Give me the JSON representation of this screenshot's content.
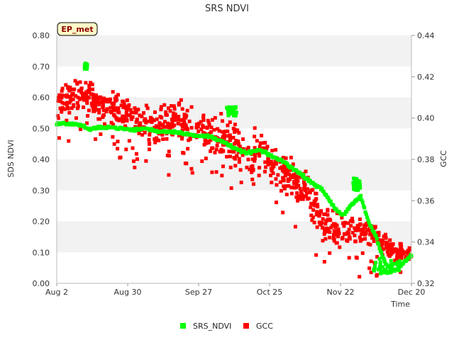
{
  "chart_data": {
    "type": "scatter",
    "title": "SRS NDVI",
    "badge": "EP_met",
    "xlabel": "Time",
    "ylabel": "SDS NDVI",
    "y2label": "GCC",
    "x_start": "Aug 2",
    "x_end": "Dec 20",
    "xlim_days": [
      0,
      140
    ],
    "xticks": [
      {
        "label": "Aug 2",
        "day": 0
      },
      {
        "label": "Aug 30",
        "day": 28
      },
      {
        "label": "Sep 27",
        "day": 56
      },
      {
        "label": "Oct 25",
        "day": 84
      },
      {
        "label": "Nov 22",
        "day": 112
      },
      {
        "label": "Dec 20",
        "day": 140
      }
    ],
    "ylim": [
      0,
      0.8
    ],
    "yticks": [
      "0.00",
      "0.10",
      "0.20",
      "0.30",
      "0.40",
      "0.50",
      "0.60",
      "0.70",
      "0.80"
    ],
    "y2lim": [
      0.32,
      0.44
    ],
    "y2ticks": [
      "0.32",
      "0.34",
      "0.36",
      "0.38",
      "0.40",
      "0.42",
      "0.44"
    ],
    "grid": "horizontal bands",
    "legend_position": "bottom-center",
    "series": [
      {
        "name": "SRS_NDVI",
        "axis": "left",
        "color": "#00ff00",
        "trend": [
          [
            0,
            0.515
          ],
          [
            5,
            0.515
          ],
          [
            10,
            0.51
          ],
          [
            13,
            0.495
          ],
          [
            15,
            0.5
          ],
          [
            20,
            0.505
          ],
          [
            25,
            0.5
          ],
          [
            30,
            0.495
          ],
          [
            35,
            0.5
          ],
          [
            40,
            0.49
          ],
          [
            45,
            0.49
          ],
          [
            50,
            0.485
          ],
          [
            55,
            0.475
          ],
          [
            60,
            0.475
          ],
          [
            65,
            0.46
          ],
          [
            70,
            0.435
          ],
          [
            75,
            0.42
          ],
          [
            80,
            0.43
          ],
          [
            85,
            0.41
          ],
          [
            90,
            0.39
          ],
          [
            95,
            0.36
          ],
          [
            100,
            0.33
          ],
          [
            105,
            0.3
          ],
          [
            110,
            0.24
          ],
          [
            113,
            0.22
          ],
          [
            116,
            0.25
          ],
          [
            120,
            0.28
          ],
          [
            123,
            0.2
          ],
          [
            126,
            0.15
          ],
          [
            128,
            0.1
          ],
          [
            130,
            0.06
          ],
          [
            133,
            0.04
          ],
          [
            136,
            0.06
          ],
          [
            140,
            0.09
          ]
        ],
        "clusters": [
          {
            "x_range": [
              67,
              71
            ],
            "y_range": [
              0.54,
              0.57
            ]
          },
          {
            "x_range": [
              11,
              12
            ],
            "y_range": [
              0.69,
              0.71
            ]
          },
          {
            "x_range": [
              117,
              120
            ],
            "y_range": [
              0.3,
              0.34
            ]
          },
          {
            "x_range": [
              125,
              136
            ],
            "y_range": [
              0.03,
              0.08
            ]
          }
        ]
      },
      {
        "name": "GCC",
        "axis": "right",
        "color": "#ff0000",
        "trend": [
          [
            0,
            0.408
          ],
          [
            5,
            0.409
          ],
          [
            10,
            0.41
          ],
          [
            13,
            0.412
          ],
          [
            15,
            0.408
          ],
          [
            20,
            0.405
          ],
          [
            25,
            0.403
          ],
          [
            30,
            0.4
          ],
          [
            35,
            0.397
          ],
          [
            40,
            0.395
          ],
          [
            45,
            0.399
          ],
          [
            50,
            0.398
          ],
          [
            55,
            0.396
          ],
          [
            60,
            0.391
          ],
          [
            65,
            0.39
          ],
          [
            70,
            0.388
          ],
          [
            75,
            0.382
          ],
          [
            80,
            0.383
          ],
          [
            85,
            0.379
          ],
          [
            90,
            0.374
          ],
          [
            95,
            0.368
          ],
          [
            100,
            0.361
          ],
          [
            105,
            0.351
          ],
          [
            110,
            0.346
          ],
          [
            115,
            0.346
          ],
          [
            120,
            0.347
          ],
          [
            125,
            0.344
          ],
          [
            130,
            0.338
          ],
          [
            135,
            0.335
          ],
          [
            140,
            0.334
          ]
        ],
        "spread": [
          [
            0,
            0.012
          ],
          [
            40,
            0.012
          ],
          [
            60,
            0.014
          ],
          [
            85,
            0.014
          ],
          [
            100,
            0.012
          ],
          [
            140,
            0.006
          ]
        ]
      }
    ]
  }
}
